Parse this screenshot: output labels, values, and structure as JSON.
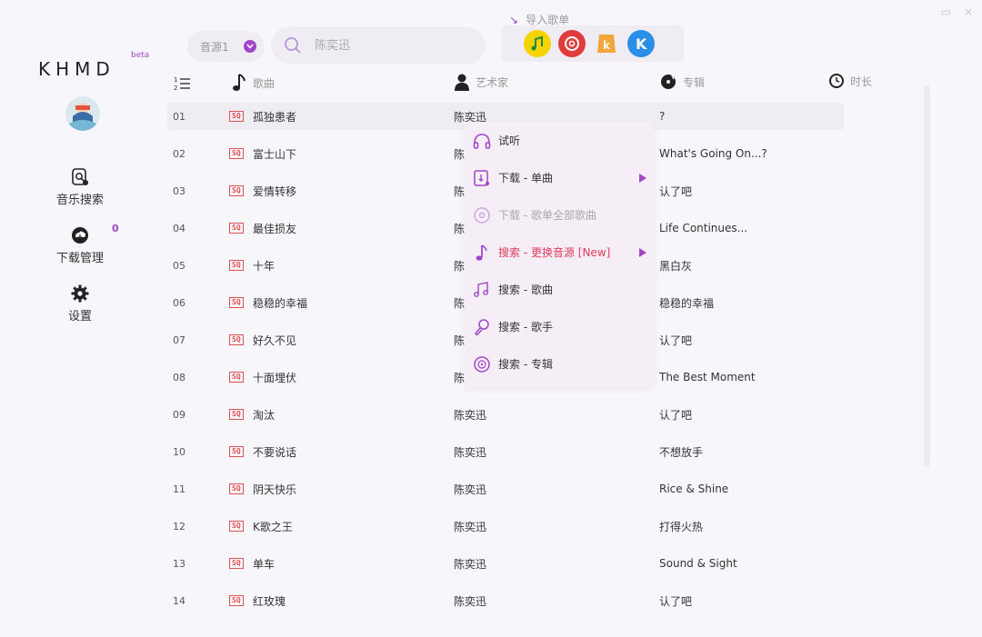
{
  "window": {
    "minimize": "▭",
    "close": "⨯"
  },
  "app": {
    "logo": "KHMD",
    "beta": "beta"
  },
  "sidebar": {
    "items": [
      {
        "label": "音乐搜索",
        "icon": "music-search-icon"
      },
      {
        "label": "下载管理",
        "icon": "download-cloud-icon",
        "badge": "0"
      },
      {
        "label": "设置",
        "icon": "gear-icon"
      }
    ]
  },
  "topbar": {
    "source_label": "音源1",
    "search_placeholder": "陈奕迅",
    "import_label": "导入歌单",
    "platforms": [
      {
        "name": "qq-music",
        "color": "#f5d300"
      },
      {
        "name": "netease",
        "color": "#e03c3c"
      },
      {
        "name": "kuwo",
        "color": "#f2a53a"
      },
      {
        "name": "kugou",
        "color": "#2b8fe8"
      }
    ]
  },
  "table": {
    "headers": {
      "song": "歌曲",
      "artist": "艺术家",
      "album": "专辑",
      "duration": "时长"
    },
    "badge": "SQ",
    "rows": [
      {
        "num": "01",
        "song": "孤独患者",
        "artist": "陈奕迅",
        "album": "?"
      },
      {
        "num": "02",
        "song": "富士山下",
        "artist": "陈",
        "album": "What's Going On...?"
      },
      {
        "num": "03",
        "song": "爱情转移",
        "artist": "陈",
        "album": "认了吧"
      },
      {
        "num": "04",
        "song": "最佳损友",
        "artist": "陈",
        "album": "Life Continues..."
      },
      {
        "num": "05",
        "song": "十年",
        "artist": "陈",
        "album": "黑白灰"
      },
      {
        "num": "06",
        "song": "稳稳的幸福",
        "artist": "陈",
        "album": "稳稳的幸福"
      },
      {
        "num": "07",
        "song": "好久不见",
        "artist": "陈",
        "album": "认了吧"
      },
      {
        "num": "08",
        "song": "十面埋伏",
        "artist": "陈",
        "album": "The Best Moment"
      },
      {
        "num": "09",
        "song": "淘汰",
        "artist": "陈奕迅",
        "album": "认了吧"
      },
      {
        "num": "10",
        "song": "不要说话",
        "artist": "陈奕迅",
        "album": "不想放手"
      },
      {
        "num": "11",
        "song": "阴天快乐",
        "artist": "陈奕迅",
        "album": "Rice & Shine"
      },
      {
        "num": "12",
        "song": "K歌之王",
        "artist": "陈奕迅",
        "album": "打得火热"
      },
      {
        "num": "13",
        "song": "单车",
        "artist": "陈奕迅",
        "album": "Sound & Sight"
      },
      {
        "num": "14",
        "song": "红玫瑰",
        "artist": "陈奕迅",
        "album": "认了吧"
      }
    ]
  },
  "context_menu": {
    "items": [
      {
        "label": "试听",
        "icon": "headphones-icon",
        "state": "normal",
        "submenu": false
      },
      {
        "label": "下载 - 单曲",
        "icon": "download-song-icon",
        "state": "normal",
        "submenu": true
      },
      {
        "label": "下载 - 歌单全部歌曲",
        "icon": "disc-icon",
        "state": "disabled",
        "submenu": false
      },
      {
        "label": "搜索 - 更换音源 [New]",
        "icon": "music-note-icon",
        "state": "highlight",
        "submenu": true
      },
      {
        "label": "搜索 - 歌曲",
        "icon": "music-notes-icon",
        "state": "normal",
        "submenu": false
      },
      {
        "label": "搜索 - 歌手",
        "icon": "microphone-icon",
        "state": "normal",
        "submenu": false
      },
      {
        "label": "搜索 - 专辑",
        "icon": "album-icon",
        "state": "normal",
        "submenu": false
      }
    ]
  },
  "colors": {
    "accent": "#a046c8",
    "highlight": "#e03c5a",
    "sq_badge": "#e05050"
  }
}
